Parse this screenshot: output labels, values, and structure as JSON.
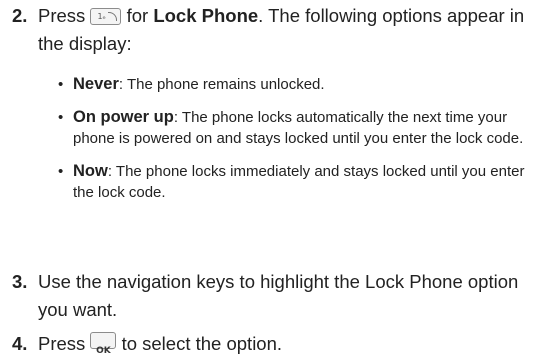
{
  "steps": [
    {
      "number": "2.",
      "text_before_key": "Press ",
      "key_icon_text": "1ₑ",
      "text_after_key": " for ",
      "bold_phrase": "Lock Phone",
      "text_end": ". The following options appear in the display:"
    },
    {
      "number": "3.",
      "text": "Use the navigation keys to highlight the Lock Phone option you want."
    },
    {
      "number": "4.",
      "text_before_key": "Press ",
      "key_icon_text": "OK",
      "text_after_key": " to select the option."
    }
  ],
  "options": [
    {
      "term": "Never",
      "description": ": The phone remains unlocked."
    },
    {
      "term": "On power up",
      "description": ": The phone locks automatically the next time your phone is powered on and stays locked until you enter the lock code."
    },
    {
      "term": "Now",
      "description": ": The phone locks immediately and stays locked until you enter the lock code."
    }
  ],
  "bullet_char": "•"
}
